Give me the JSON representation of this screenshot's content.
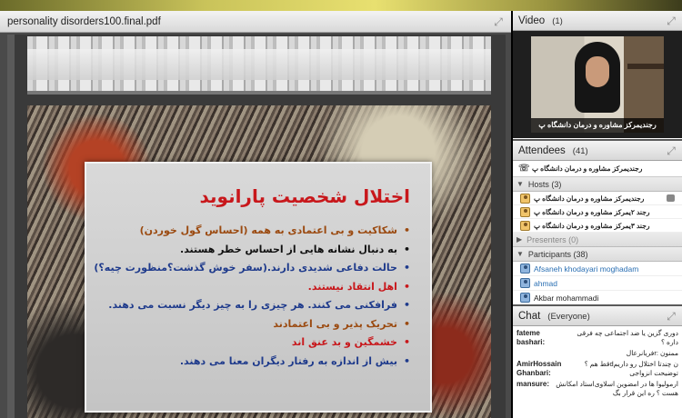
{
  "share_pod": {
    "title": "personality disorders100.final.pdf"
  },
  "slide": {
    "title": "اختلال شخصیت پارانوید",
    "bullets": [
      {
        "text": "شکاکیت و بی اعتمادی به همه (احساس گول خوردن)",
        "color": "#9b4a10"
      },
      {
        "text": "به دنبال نشانه هایی از احساس خطر هستند.",
        "color": "#111111"
      },
      {
        "text": "حالت دفاعی شدیدی دارند.(سفر خوش گذشت؟منظورت چیه؟)",
        "color": "#1f3b8c"
      },
      {
        "text": "اهل انتقاد نیستند.",
        "color": "#c8171b"
      },
      {
        "text": "فرافکنی می کنند. هر چیزی را به چیز دیگر نسبت می دهند.",
        "color": "#1f3b8c"
      },
      {
        "text": "تحریک پذیر و بی اعتمادند",
        "color": "#9b4a10"
      },
      {
        "text": "خشمگین و بد عنق اند",
        "color": "#c8171b"
      },
      {
        "text": "بیش از اندازه به رفتار دیگران معنا می دهند.",
        "color": "#1f3b8c"
      }
    ]
  },
  "video_pod": {
    "title": "Video",
    "count": "(1)",
    "caption": "رجندیمرکز مشاوره و درمان دانشگاه پ"
  },
  "attendees_pod": {
    "title": "Attendees",
    "count": "(41)",
    "current_user": "رجندیمرکز مشاوره و درمان دانشگاه پ",
    "hosts_label": "Hosts (3)",
    "hosts": [
      "رجندیمرکز مشاوره و درمان دانشگاه پ",
      "رجند ۲یمرکز مشاوره و درمان دانشگاه پ",
      "رجند ۳یمرکز مشاوره و درمان دانشگاه پ"
    ],
    "presenters_label": "Presenters (0)",
    "participants_label": "Participants (38)",
    "participants": [
      {
        "name": "Afsaneh khodayari moghadam",
        "highlight": true
      },
      {
        "name": "ahmad",
        "highlight": true
      },
      {
        "name": "Akbar mohammadi",
        "highlight": false
      },
      {
        "name": "AmirHossain Ghanbari",
        "highlight": false
      }
    ]
  },
  "chat_pod": {
    "title": "Chat",
    "scope": "(Everyone)",
    "messages": [
      {
        "sender": "fateme bashari:",
        "text": "دوری گزین یا ضد اجتماعی چه فرقی داره ؟"
      },
      {
        "sender": "",
        "text": "ممنون :rفریانرعال"
      },
      {
        "sender": "AmirHossain Ghanbari:",
        "text": "ن چندتا اختلال رو داریمdقط هم ؟ توضیحت انزواجی"
      },
      {
        "sender": "mansure:",
        "text": "ارمولیوا ها در امضوین اسلاوی‌استاد امکانش هست ؟ ره این قرار بگ"
      }
    ]
  }
}
